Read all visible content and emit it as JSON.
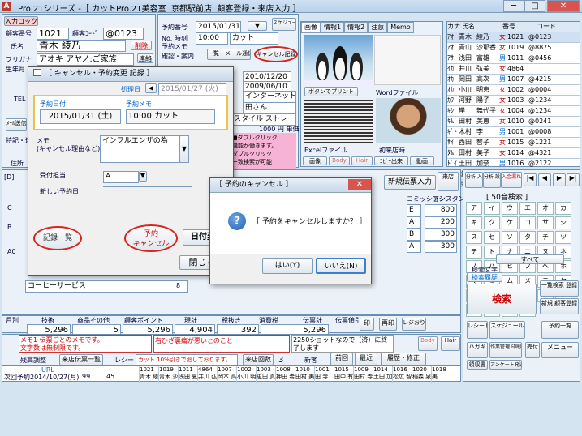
{
  "title": {
    "app": "Pro.21シリーズ",
    "window": "-［ カットPro.21美容室  京都駅前店  顧客登録・来店入力 ］"
  },
  "titlebar": {
    "min": "─",
    "max": "□",
    "close": "✕"
  },
  "top": {
    "entry_label": "入力ロック",
    "cust_no_label": "顧客番号",
    "cust_no": "1021",
    "card_label": "顧客ｺｰﾄﾞ",
    "card": "@0123",
    "name_label": "氏名",
    "name": "青木 綾乃",
    "tag": "削除",
    "furi_label": "フリガナ",
    "furi": "アオキ アヤノ:ご家族",
    "renraku": "連絡",
    "birth_label": "生年月",
    "tel_label": "TEL",
    "memo_btn": "ﾒｰﾙ送信",
    "tokki_label": "特記・連",
    "jusho_label": "住所"
  },
  "visit": {
    "kind_label": "予約番号",
    "date": "2015/01/31",
    "time_label": "No. 時刻",
    "time": "10:00",
    "menu": "カット",
    "yoyaku_memo_label": "予約メモ",
    "kakunin": "確認・案内",
    "ichiran_btn": "一覧・メール通信",
    "cancel_btn": "キャンセル記録",
    "sched_btn": "スケジュール",
    "date2": "2010/12/20",
    "date3": "2009/06/10",
    "channel": "インターネット",
    "staff": "田さん",
    "style": "スタイル ストレート",
    "price": "1000 円 単価",
    "note1": "■ダブルクリック",
    "note2": "機能が働きます。",
    "note3": "ダブルクリック",
    "note4": "ー致検索が可能"
  },
  "photos": {
    "tabs": [
      "画像",
      "情報1",
      "情報2",
      "注意",
      "Memo"
    ],
    "btn_print": "ボタンでプリント",
    "word_file": "Wordファイル",
    "excel_file": "Excelファイル",
    "first_visit": "初来店時",
    "img_btn": "画像",
    "body": "Body",
    "hair": "Hair",
    "pcopy": "ｺﾋﾟｰ出来",
    "movie": "動画"
  },
  "customer_list": {
    "header": [
      "カナ",
      "氏名",
      "",
      "番号",
      "コード"
    ],
    "rows": [
      [
        "ｱｵ",
        "青木",
        "綾乃",
        "女",
        "1021",
        "@0123"
      ],
      [
        "ｱｵ",
        "青山",
        "沙耶香",
        "女",
        "1019",
        "@8875"
      ],
      [
        "ｱｻ",
        "浅田",
        "富雄",
        "男",
        "1011",
        "@0456"
      ],
      [
        "ｲｶ",
        "井川",
        "弘美",
        "女",
        "4864",
        ""
      ],
      [
        "ｵｶ",
        "岡田",
        "高次",
        "男",
        "1007",
        "@4215"
      ],
      [
        "ｵｶ",
        "小川",
        "明恵",
        "女",
        "1002",
        "@0004"
      ],
      [
        "ｶﾜ",
        "河野",
        "陽子",
        "女",
        "1003",
        "@1234"
      ],
      [
        "ｷｼ",
        "岸",
        "舞代子",
        "女",
        "1004",
        "@1234"
      ],
      [
        "ｷﾑ",
        "田村",
        "美恵",
        "女",
        "1010",
        "@0241"
      ],
      [
        "ｷﾞﾄ",
        "木村",
        "李",
        "男",
        "1001",
        "@0008"
      ],
      [
        "ｻｲ",
        "西田",
        "智子",
        "女",
        "1015",
        "@1221"
      ],
      [
        "ﾀﾑ",
        "田村",
        "美子",
        "女",
        "1014",
        "@4321"
      ],
      [
        "ﾄﾞｲ",
        "土田",
        "加奈",
        "男",
        "1016",
        "@2122"
      ],
      [
        "ﾏﾂ",
        "松広",
        "智子",
        "女",
        "1020",
        "@1645"
      ],
      [
        "ﾓﾘ",
        "森",
        "葉子",
        "女",
        "1014",
        "@6552"
      ]
    ]
  },
  "cancel_dlg": {
    "title": "［ キャンセル・予約変更 記録 ］",
    "proc_label": "処理日",
    "proc_date": "2015/01/27 (火)",
    "date_label": "予約日付",
    "date": "2015/01/31 (土)",
    "memo_label": "予約メモ",
    "memo": "10:00 カット",
    "reason_label": "メモ\n(キャンセル理由など)",
    "reason": "インフルエンザの為",
    "staff_label": "受付担当",
    "staff": "A",
    "new_date_label": "新しい予約日",
    "btn_list": "記録一覧",
    "btn_cancel": "予約\nキャンセル",
    "btn_change": "日付変",
    "btn_close": "閉じる"
  },
  "confirm": {
    "title": "［ 予約のキャンセル ］",
    "msg": "［ 予約をキャンセルしますか？ ］",
    "yes": "はい(Y)",
    "no": "いいえ(N)",
    "close": "✕"
  },
  "tabs_mid": {
    "label": "[D]",
    "new_slip": "新規伝票入力",
    "mark": "来店"
  },
  "mid": {
    "staff_col": "コミッション",
    "assist_col": "アシスタント",
    "col_values": [
      "800",
      "200",
      "300",
      "300"
    ],
    "staffs": [
      "E",
      "A",
      "B",
      "A"
    ],
    "item": "コーヒーサービス",
    "qty": "8",
    "sum_labels": [
      "技術",
      "商品その他",
      "顧客ポイント",
      "現計",
      "税抜き",
      "消費税",
      "伝票計"
    ],
    "sums": [
      "5,296",
      "5",
      "5,296",
      "4,904",
      "392",
      "5,296"
    ],
    "discount": "伝票値引",
    "stamp": "印",
    "reprint": "再印",
    "regi": "レジおりり"
  },
  "memo": {
    "memo1": "メモ1 伝票ごとのメモです。",
    "memo2": "文字数は無制限です。",
    "sub": "右ひざ裏痛が悪いとのこと",
    "shots": "2250ショットなので（済）に終了します",
    "tax": "残高調整",
    "slip_list": "来店伝票一覧",
    "receipt": "レシート",
    "receipt_msg": "カット 10%引きで廻しております。",
    "visit_count_label": "来店回数",
    "visit_count": "3",
    "new_label": "新客",
    "prev": "前回",
    "latest": "最近",
    "history": "履歴・修正",
    "next_label": "次回予約",
    "next_date": "2014/10/27(月)",
    "next_v1": "99",
    "next_v2": "45",
    "url": "URL"
  },
  "history": {
    "cols": [
      "1021",
      "1019",
      "1011",
      "4864",
      "1007",
      "1002",
      "1003",
      "1008",
      "1010",
      "1001",
      "1015",
      "1009",
      "1014",
      "1016",
      "1020",
      "1018"
    ],
    "names": [
      "青木 綾",
      "青木 沙",
      "浅田 夏",
      "井川 弘",
      "岡本 高",
      "小川 明",
      "恵田 真",
      "押田 希",
      "田村 美",
      "田 寺",
      "田中 有",
      "田村 寺",
      "土田 加",
      "松広 智",
      "稲森 泉",
      "美"
    ]
  },
  "kana": {
    "search": "[ 50音検索 ]",
    "rows": [
      "ア",
      "イ",
      "ウ",
      "エ",
      "オ",
      "カ",
      "キ",
      "ク",
      "ケ",
      "コ",
      "サ",
      "シ",
      "ス",
      "セ",
      "ソ",
      "タ",
      "チ",
      "ツ",
      "テ",
      "ト",
      "ナ",
      "ニ",
      "ヌ",
      "ネ",
      "ノ",
      "ハ",
      "ヒ",
      "フ",
      "ヘ",
      "ホ",
      "マ",
      "ミ",
      "ム",
      "メ",
      "モ",
      "ヤ",
      "ユ",
      "ヨ",
      "ラ",
      "リ",
      "ル",
      "レ",
      "ロ",
      "ワ",
      "ヲ",
      "ン"
    ],
    "all": "すべて",
    "search_label": "検索文字",
    "search_hist": "検索履歴",
    "search_btn": "検索",
    "list_btn": "一覧検索\n登録",
    "new_reg": "新規\n顧客登録",
    "receipt": "レシート\n発行",
    "schedule": "スケジュール",
    "order": "予約一覧",
    "hagaki": "ハガキ",
    "sakusei": "作業管理\n印刷",
    "uri": "売付",
    "menu": "メニュー",
    "uri2": "領収書",
    "mail": "アンケート発送"
  },
  "nav": {
    "tenki": "分析\n入力",
    "settei": "分析\n設定",
    "nyuka": "入金漏れ\n確認",
    "first": "|◀",
    "prev": "◀",
    "next": "▶",
    "last": "▶|"
  },
  "left_side": {
    "a1": "月別\n報告",
    "a2": "明細\n伝票",
    "a3": "伝票\n出力"
  }
}
